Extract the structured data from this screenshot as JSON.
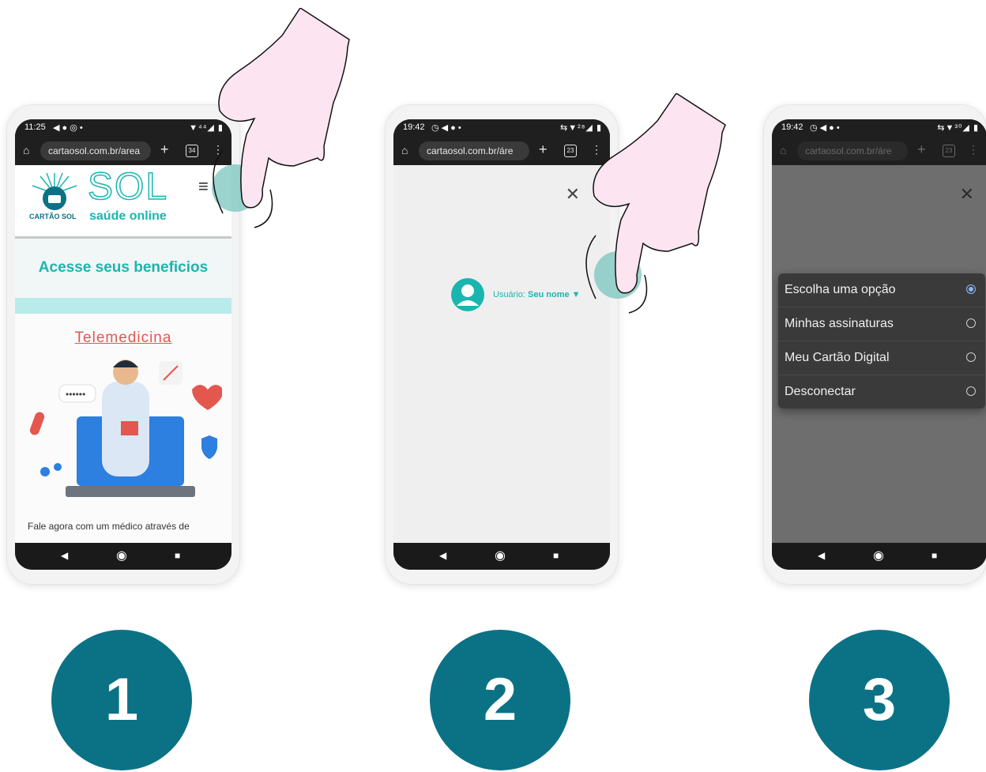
{
  "phone1": {
    "status_time": "11:25",
    "status_icons": "◀ ● ◎ •",
    "status_right": "▼⁴⁴◢ ▮",
    "url": "cartaosol.com.br/area",
    "tab_count": "34",
    "logo_small": "CARTÃO SOL",
    "logo_big": "SOL",
    "logo_sub": "saúde online",
    "heading": "Acesse seus beneficios",
    "link": "Telemedicina",
    "body_text": "Fale agora com um médico através de"
  },
  "phone2": {
    "status_time": "19:42",
    "status_icons": "◷ ◀ ● •",
    "status_right": "⇆▼²⁸◢ ▮",
    "url": "cartaosol.com.br/áre",
    "tab_count": "23",
    "user_label": "Usuário:",
    "user_name": "Seu nome"
  },
  "phone3": {
    "status_time": "19:42",
    "status_icons": "◷ ◀ ● •",
    "status_right": "⇆▼³⁰◢ ▮",
    "url": "cartaosol.com.br/áre",
    "tab_count": "23",
    "options": [
      "Escolha uma opção",
      "Minhas assinaturas",
      "Meu Cartão Digital",
      "Desconectar"
    ],
    "selected_index": 0
  },
  "steps": [
    "1",
    "2",
    "3"
  ],
  "colors": {
    "teal": "#0b7286",
    "accent": "#1bb5b0",
    "coral": "#e3574f",
    "hand": "#fce4f1"
  }
}
